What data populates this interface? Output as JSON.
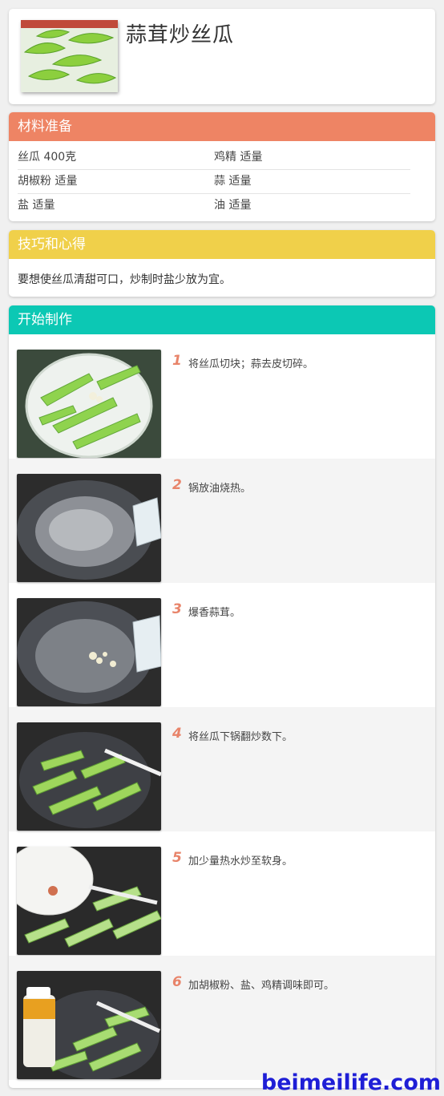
{
  "recipe": {
    "title": "蒜茸炒丝瓜"
  },
  "ingredients": {
    "heading": "材料准备",
    "heading_color": "#ee8464",
    "items": [
      "丝瓜 400克",
      "鸡精 适量",
      "胡椒粉 适量",
      "蒜 适量",
      "盐 适量",
      "油 适量"
    ]
  },
  "tips": {
    "heading": "技巧和心得",
    "heading_color": "#f0d04a",
    "text": "要想使丝瓜清甜可口，炒制时盐少放为宜。"
  },
  "steps": {
    "heading": "开始制作",
    "heading_color": "#0cc8b4",
    "items": [
      {
        "num": "1",
        "text": "将丝瓜切块；蒜去皮切碎。"
      },
      {
        "num": "2",
        "text": "锅放油烧热。"
      },
      {
        "num": "3",
        "text": "爆香蒜茸。"
      },
      {
        "num": "4",
        "text": "将丝瓜下锅翻炒数下。"
      },
      {
        "num": "5",
        "text": "加少量热水炒至软身。"
      },
      {
        "num": "6",
        "text": "加胡椒粉、盐、鸡精调味即可。"
      }
    ]
  },
  "watermark": "beimeilife.com"
}
